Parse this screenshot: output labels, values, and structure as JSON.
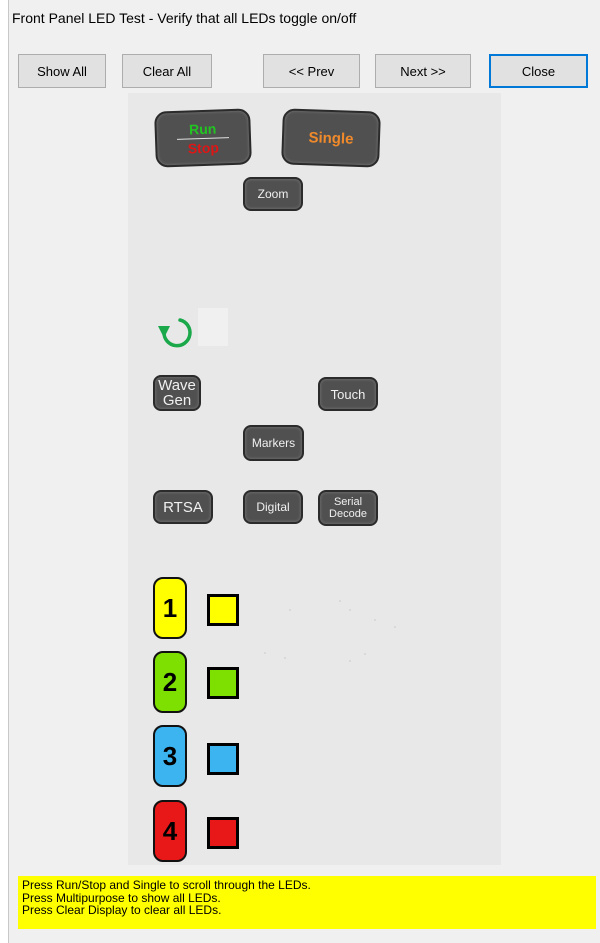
{
  "window": {
    "title": "Front Panel LED Test - Verify that all LEDs toggle on/off"
  },
  "toolbar": {
    "show_all": "Show All",
    "clear_all": "Clear All",
    "prev": "<< Prev",
    "next": "Next >>",
    "close": "Close"
  },
  "panel": {
    "run": "Run",
    "stop": "Stop",
    "single": "Single",
    "zoom": "Zoom",
    "wave_line1": "Wave",
    "wave_line2": "Gen",
    "touch": "Touch",
    "markers": "Markers",
    "rtsa": "RTSA",
    "digital": "Digital",
    "serial_line1": "Serial",
    "serial_line2": "Decode",
    "channels": [
      {
        "label": "1",
        "color": "#ffff00"
      },
      {
        "label": "2",
        "color": "#7ee000"
      },
      {
        "label": "3",
        "color": "#3cb4f0"
      },
      {
        "label": "4",
        "color": "#e81818"
      }
    ],
    "colors": {
      "run": "#22c422",
      "stop": "#e01515",
      "single": "#f08a2a",
      "refresh_arrow": "#1aa84a"
    }
  },
  "instructions": {
    "line1": "Press Run/Stop and Single to scroll through the LEDs.",
    "line2": "Press Multipurpose to show all LEDs.",
    "line3": "Press Clear Display to clear all LEDs."
  }
}
